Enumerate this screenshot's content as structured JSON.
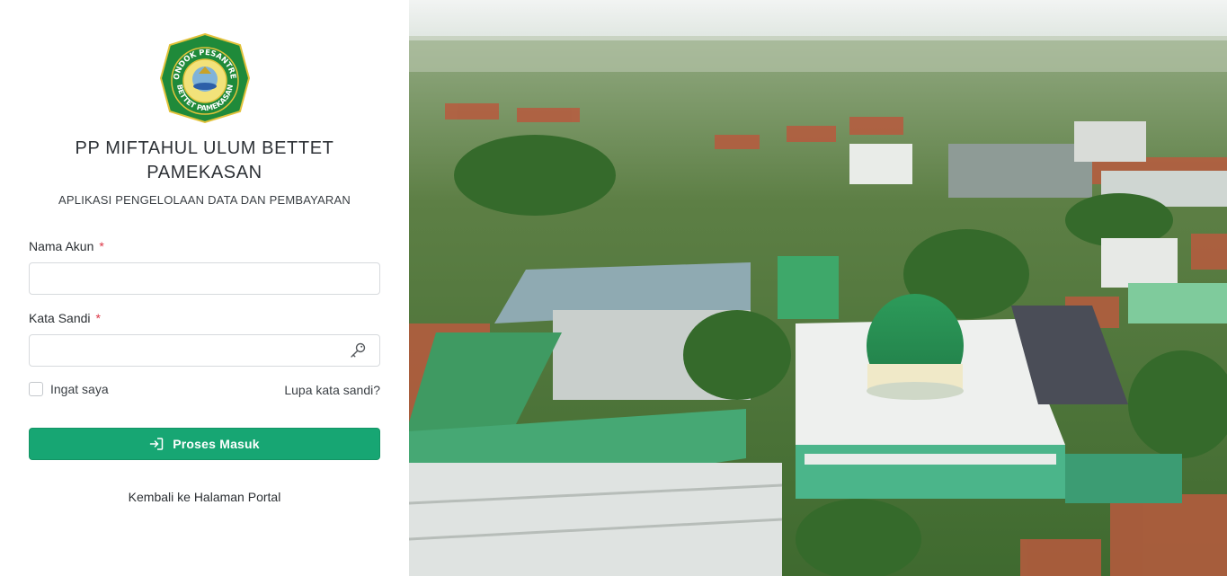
{
  "brand": {
    "logo_ring_text_top": "PONDOK PESANTREN",
    "logo_ring_text_bottom": "BETTET PAMEKASAN",
    "title": "PP MIFTAHUL ULUM BETTET PAMEKASAN",
    "subtitle": "APLIKASI PENGELOLAAN DATA DAN PEMBAYARAN"
  },
  "form": {
    "username_label": "Nama Akun",
    "password_label": "Kata Sandi",
    "required_mark": "*",
    "username_value": "",
    "password_value": "",
    "remember_label": "Ingat saya",
    "remember_checked": false,
    "forgot_label": "Lupa kata sandi?",
    "submit_label": "Proses Masuk",
    "submit_icon": "login-icon",
    "password_icon": "key-icon"
  },
  "footer": {
    "back_label": "Kembali ke Halaman Portal"
  },
  "colors": {
    "primary": "#17a673",
    "required": "#dc3545",
    "logo_green": "#1f8a3a",
    "logo_gold": "#e2c23b"
  },
  "background_photo": "aerial-campus-photo"
}
